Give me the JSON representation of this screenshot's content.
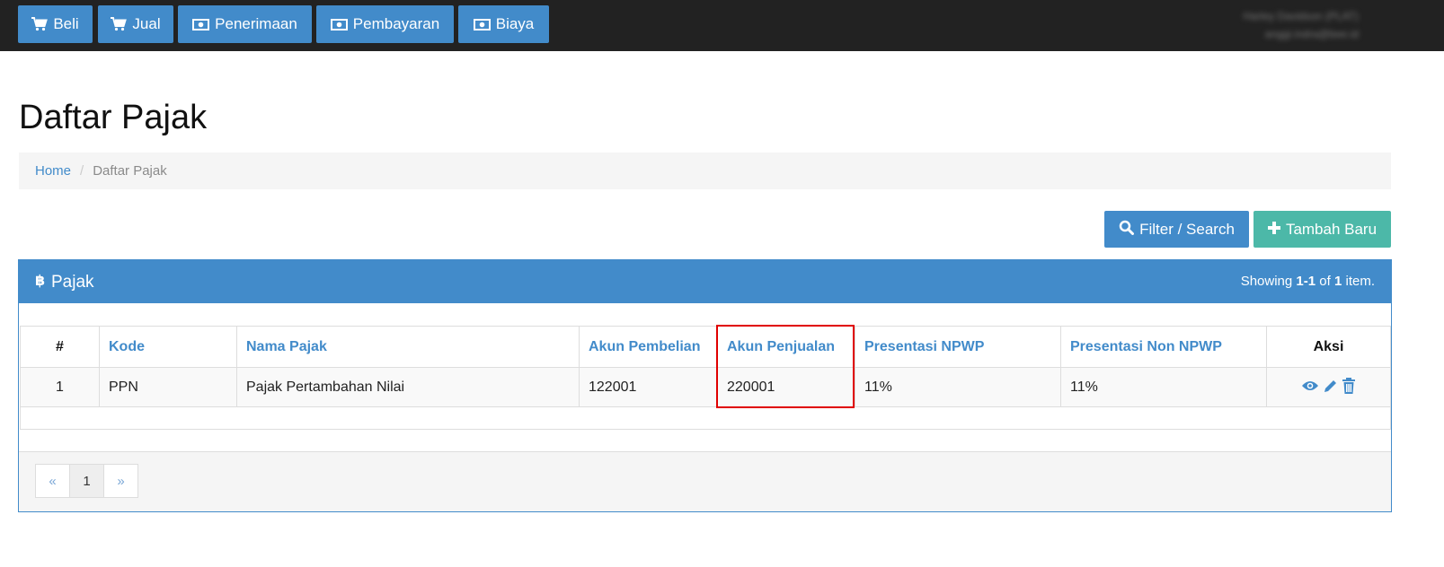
{
  "navbar": {
    "items": [
      {
        "label": "Beli",
        "icon": "cart-icon"
      },
      {
        "label": "Jual",
        "icon": "cart-icon"
      },
      {
        "label": "Penerimaan",
        "icon": "money-icon"
      },
      {
        "label": "Pembayaran",
        "icon": "money-icon"
      },
      {
        "label": "Biaya",
        "icon": "money-icon"
      }
    ],
    "user_name": "Harley Davidson (PLAT)",
    "user_email": "anggi.indra@bee.id"
  },
  "page": {
    "title": "Daftar Pajak"
  },
  "breadcrumb": {
    "home": "Home",
    "current": "Daftar Pajak"
  },
  "actions": {
    "filter_label": "Filter / Search",
    "add_label": "Tambah Baru"
  },
  "panel": {
    "title": "Pajak",
    "summary_prefix": "Showing ",
    "summary_range": "1-1",
    "summary_mid": " of ",
    "summary_total": "1",
    "summary_suffix": " item."
  },
  "table": {
    "headers": [
      "#",
      "Kode",
      "Nama Pajak",
      "Akun Pembelian",
      "Akun Penjualan",
      "Presentasi NPWP",
      "Presentasi Non NPWP",
      "Aksi"
    ],
    "rows": [
      [
        "1",
        "PPN",
        "Pajak Pertambahan Nilai",
        "122001",
        "220001",
        "11%",
        "11%"
      ]
    ],
    "highlighted_column": "Akun Penjualan"
  },
  "pagination": {
    "prev": "«",
    "page": "1",
    "next": "»"
  },
  "colors": {
    "primary": "#428bca",
    "success": "#4cb8a8",
    "navbar": "#222222",
    "highlight": "#e00000"
  }
}
